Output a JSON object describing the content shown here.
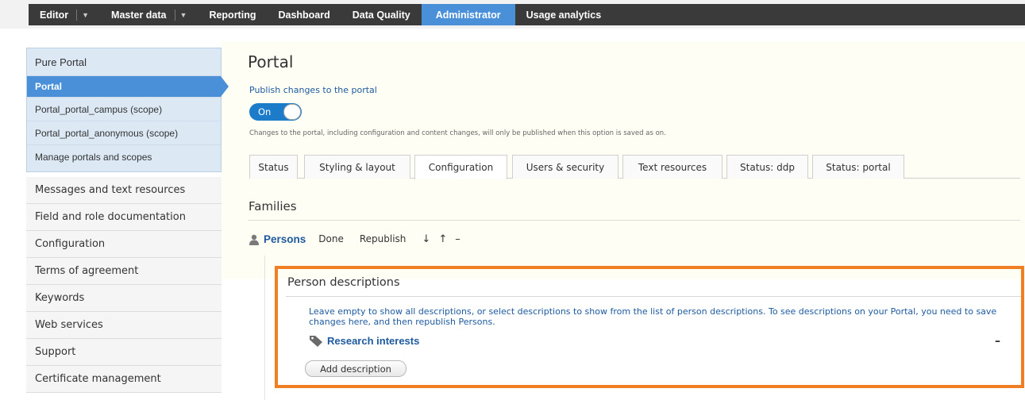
{
  "nav": {
    "items": [
      {
        "label": "Editor",
        "dropdown": true
      },
      {
        "label": "Master data",
        "dropdown": true
      },
      {
        "label": "Reporting",
        "dropdown": false
      },
      {
        "label": "Dashboard",
        "dropdown": false
      },
      {
        "label": "Data Quality",
        "dropdown": false
      },
      {
        "label": "Administrator",
        "dropdown": false,
        "active": true
      },
      {
        "label": "Usage analytics",
        "dropdown": false
      }
    ],
    "caret": "▼"
  },
  "sidebar": {
    "section_title": "Pure Portal",
    "section_items": [
      {
        "label": "Portal",
        "active": true
      },
      {
        "label": "Portal_portal_campus (scope)"
      },
      {
        "label": "Portal_portal_anonymous (scope)"
      },
      {
        "label": "Manage portals and scopes"
      }
    ],
    "items": [
      {
        "label": "Messages and text resources"
      },
      {
        "label": "Field and role documentation"
      },
      {
        "label": "Configuration"
      },
      {
        "label": "Terms of agreement"
      },
      {
        "label": "Keywords"
      },
      {
        "label": "Web services"
      },
      {
        "label": "Support"
      },
      {
        "label": "Certificate management"
      }
    ]
  },
  "main": {
    "title": "Portal",
    "publish_label": "Publish changes to the portal",
    "toggle_label": "On",
    "changes_note": "Changes to the portal, including configuration and content changes, will only be published when this option is saved as on.",
    "tabs": [
      {
        "label": "Status"
      },
      {
        "label": "Styling & layout"
      },
      {
        "label": "Configuration",
        "active": true
      },
      {
        "label": "Users & security"
      },
      {
        "label": "Text resources"
      },
      {
        "label": "Status: ddp"
      },
      {
        "label": "Status: portal"
      }
    ],
    "families_heading": "Families",
    "persons": {
      "label": "Persons",
      "done": "Done",
      "republish": "Republish",
      "move_down": "↓",
      "move_up": "↑",
      "remove": "–"
    },
    "person_descriptions": {
      "title": "Person descriptions",
      "description": "Leave empty to show all descriptions, or select descriptions to show from the list of person descriptions. To see descriptions on your Portal, you need to save changes here, and then republish Persons.",
      "item_label": "Research interests",
      "item_remove": "–",
      "add_button": "Add description"
    }
  },
  "colors": {
    "nav_bg": "#3a3a3a",
    "accent_blue": "#4a90d9",
    "link_blue": "#1d5a9e",
    "highlight_orange": "#f07f24"
  }
}
